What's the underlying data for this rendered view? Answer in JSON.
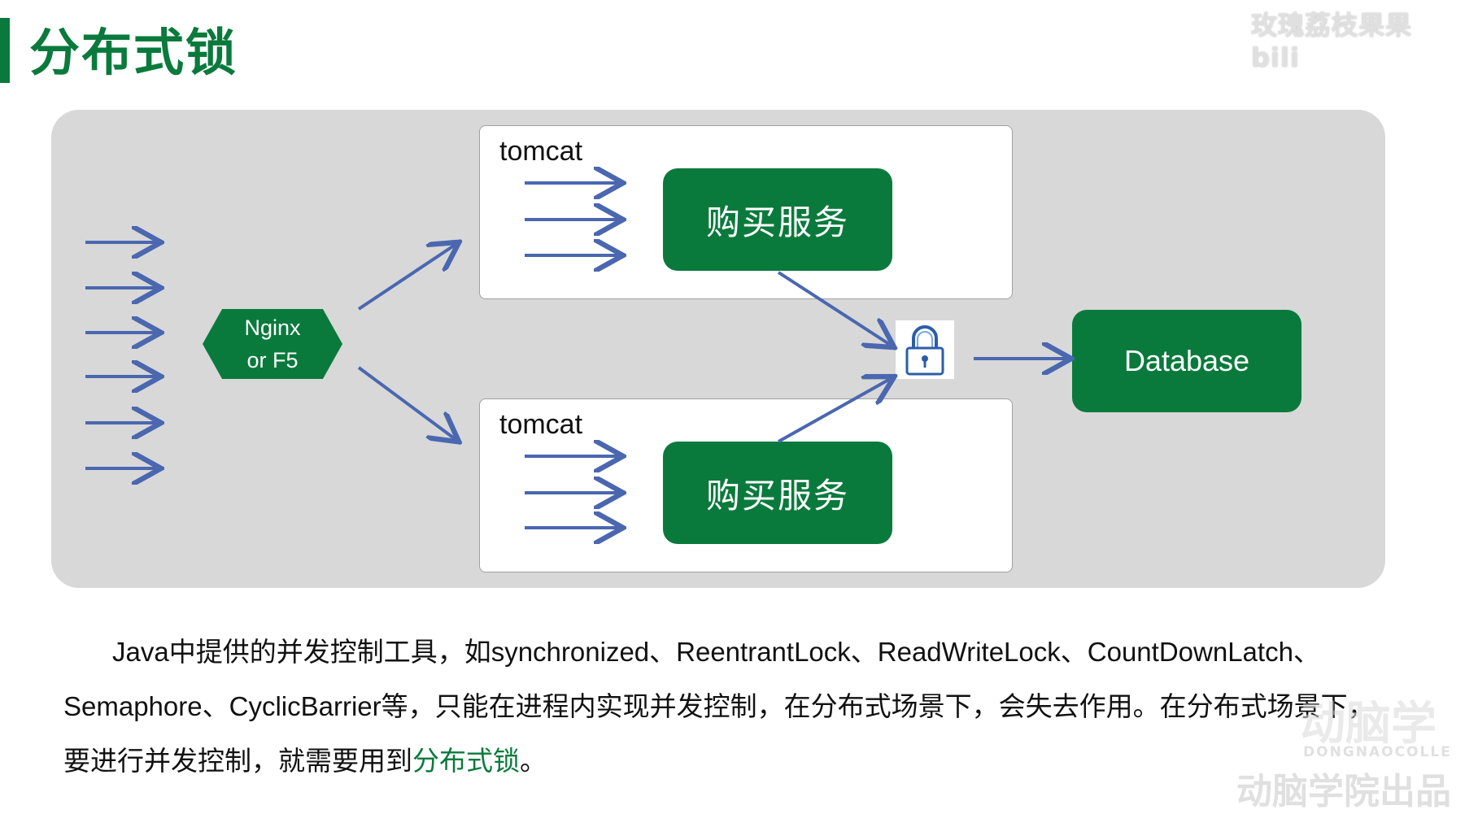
{
  "header": {
    "title": "分布式锁",
    "watermark": "玫瑰荔枝果果 bili"
  },
  "diagram": {
    "nginx": {
      "line1": "Nginx",
      "line2": "or F5"
    },
    "tomcat_top": {
      "label": "tomcat",
      "service": "购买服务"
    },
    "tomcat_bottom": {
      "label": "tomcat",
      "service": "购买服务"
    },
    "lock": {
      "icon": "lock-icon"
    },
    "database": {
      "label": "Database"
    }
  },
  "paragraph": {
    "part1": "Java中提供的并发控制工具，如synchronized、ReentrantLock、ReadWriteLock、CountDownLatch、Semaphore、CyclicBarrier等，只能在进程内实现并发控制，在分布式场景下，会失去作用。在分布式场景下，要进行并发控制，就需要用到",
    "highlight": "分布式锁",
    "end": "。"
  },
  "watermark_bottom": {
    "line1": "动脑学",
    "line2": "DONGNAOCOLLE",
    "line3": "动脑学院出品"
  },
  "colors": {
    "brand_green": "#0a7a3c",
    "arrow_blue": "#4a67b0",
    "diagram_bg": "#d8d8d8"
  }
}
